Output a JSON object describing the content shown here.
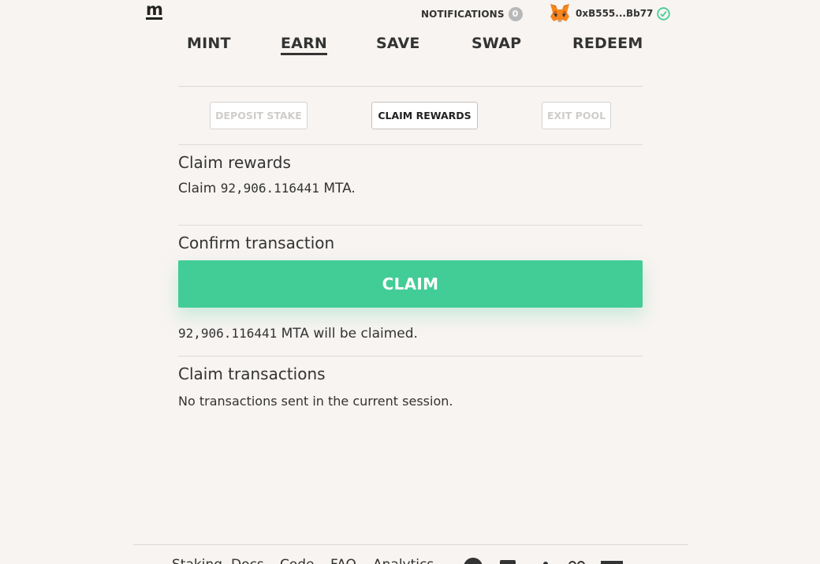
{
  "header": {
    "logo": "m",
    "notifications_label": "NOTIFICATIONS",
    "notifications_count": "0",
    "wallet_address": "0xB555...Bb77"
  },
  "nav": {
    "items": [
      "MINT",
      "EARN",
      "SAVE",
      "SWAP",
      "REDEEM"
    ],
    "active": "EARN"
  },
  "tabs": {
    "deposit": "DEPOSIT STAKE",
    "claim": "CLAIM REWARDS",
    "exit": "EXIT POOL"
  },
  "claim_rewards": {
    "title": "Claim rewards",
    "prefix": "Claim",
    "amount": "92,906.116441",
    "suffix": "MTA."
  },
  "confirm": {
    "title": "Confirm transaction",
    "button": "CLAIM",
    "amount": "92,906.116441",
    "summary_suffix": "MTA will be claimed."
  },
  "transactions": {
    "title": "Claim transactions",
    "empty": "No transactions sent in the current session."
  },
  "footer": {
    "links": [
      "Staking",
      "Docs",
      "Code",
      "FAQ",
      "Analytics"
    ]
  },
  "colors": {
    "accent": "#43cd96",
    "background": "#f7f4f1",
    "check": "#43cd96"
  }
}
